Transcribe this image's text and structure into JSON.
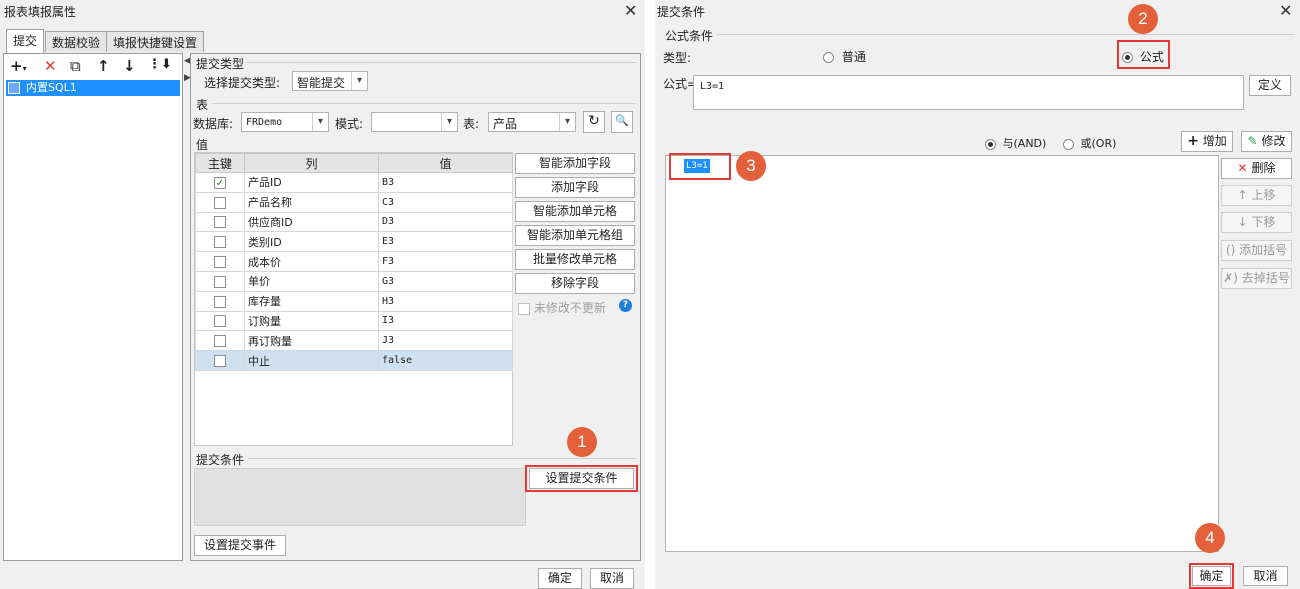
{
  "left_dialog": {
    "title": "报表填报属性",
    "tabs": [
      "提交",
      "数据校验",
      "填报快捷键设置"
    ],
    "tree_item": "内置SQL1",
    "submit_type_section": "提交类型",
    "submit_type_label": "选择提交类型:",
    "submit_type_value": "智能提交",
    "table_section": "表",
    "db_label": "数据库:",
    "db_value": "FRDemo",
    "mode_label": "模式:",
    "mode_value": "",
    "table_label": "表:",
    "table_value": "产品",
    "value_section": "值",
    "columns": [
      "主键",
      "列",
      "值"
    ],
    "rows": [
      {
        "key": true,
        "col": "产品ID",
        "val": "B3"
      },
      {
        "key": false,
        "col": "产品名称",
        "val": "C3"
      },
      {
        "key": false,
        "col": "供应商ID",
        "val": "D3"
      },
      {
        "key": false,
        "col": "类别ID",
        "val": "E3"
      },
      {
        "key": false,
        "col": "成本价",
        "val": "F3"
      },
      {
        "key": false,
        "col": "单价",
        "val": "G3"
      },
      {
        "key": false,
        "col": "库存量",
        "val": "H3"
      },
      {
        "key": false,
        "col": "订购量",
        "val": "I3"
      },
      {
        "key": false,
        "col": "再订购量",
        "val": "J3"
      },
      {
        "key": false,
        "col": "中止",
        "val": "false"
      }
    ],
    "side_buttons": [
      "智能添加字段",
      "添加字段",
      "智能添加单元格",
      "智能添加单元格组",
      "批量修改单元格",
      "移除字段"
    ],
    "no_update_label": "未修改不更新",
    "submit_condition_section": "提交条件",
    "set_condition_button": "设置提交条件",
    "set_event_button": "设置提交事件",
    "ok": "确定",
    "cancel": "取消",
    "badge": "1"
  },
  "right_dialog": {
    "title": "提交条件",
    "formula_section": "公式条件",
    "type_label": "类型:",
    "radio_normal": "普通",
    "radio_formula": "公式",
    "formula_label": "公式=",
    "formula_value": "L3=1",
    "define_button": "定义",
    "and_label": "与(AND)",
    "or_label": "或(OR)",
    "add_button": "增加",
    "modify_button": "修改",
    "delete_button": "删除",
    "up_button": "上移",
    "down_button": "下移",
    "add_bracket_button": "添加括号",
    "remove_bracket_button": "去掉括号",
    "list_item": "L3=1",
    "ok": "确定",
    "cancel": "取消",
    "badges": [
      "2",
      "3",
      "4"
    ]
  }
}
